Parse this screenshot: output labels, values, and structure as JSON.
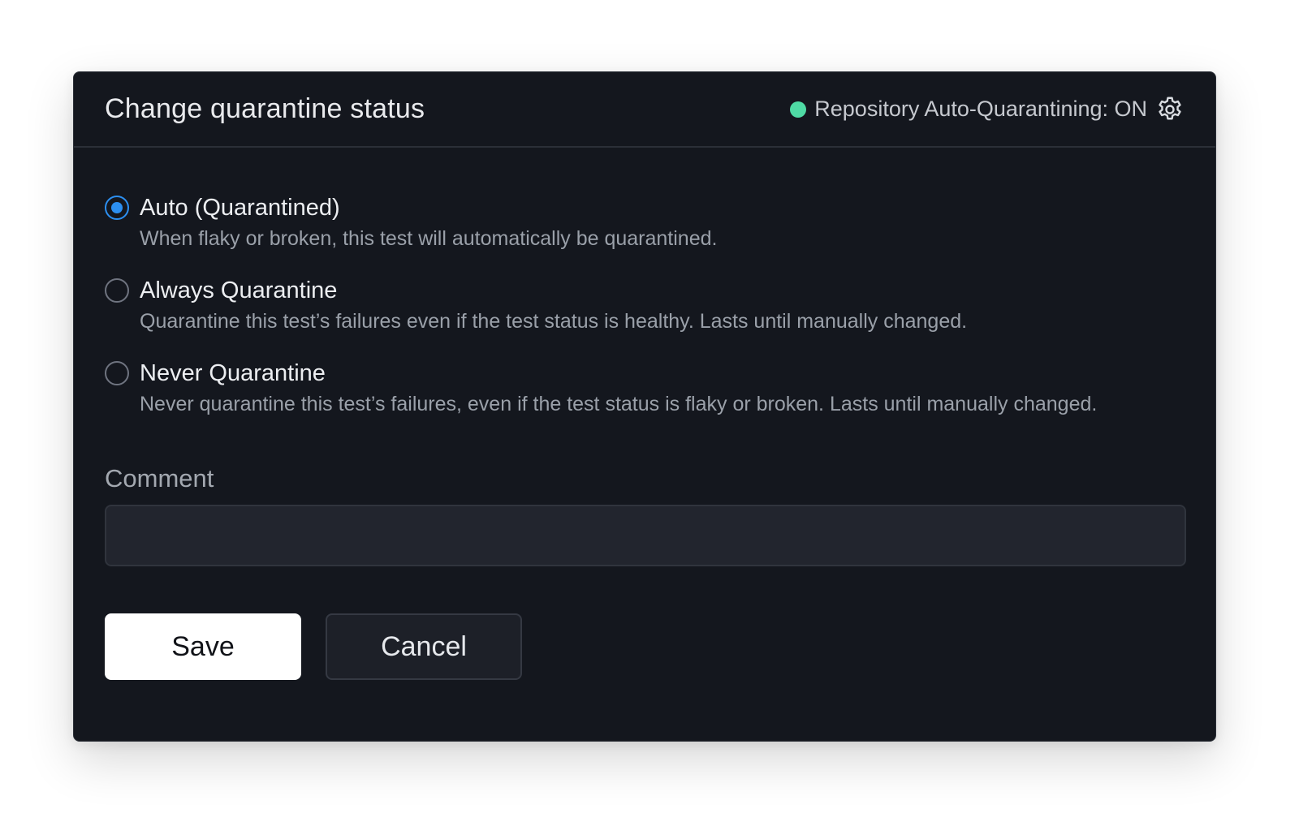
{
  "modal": {
    "title": "Change quarantine status",
    "status": {
      "text": "Repository Auto-Quarantining: ON",
      "dot_color": "#4fdba5",
      "settings_icon": "gear-icon"
    }
  },
  "options": [
    {
      "label": "Auto (Quarantined)",
      "description": "When flaky or broken, this test will automatically be quarantined.",
      "selected": true
    },
    {
      "label": "Always Quarantine",
      "description": "Quarantine this test’s failures even if the test status is healthy. Lasts until manually changed.",
      "selected": false
    },
    {
      "label": "Never Quarantine",
      "description": "Never quarantine this test’s failures, even if the test status is flaky or broken. Lasts until manually changed.",
      "selected": false
    }
  ],
  "comment": {
    "label": "Comment",
    "value": "",
    "placeholder": ""
  },
  "buttons": {
    "save_label": "Save",
    "cancel_label": "Cancel"
  },
  "colors": {
    "accent": "#2c8ff0",
    "modal_bg": "#14171e",
    "status_on": "#4fdba5"
  }
}
